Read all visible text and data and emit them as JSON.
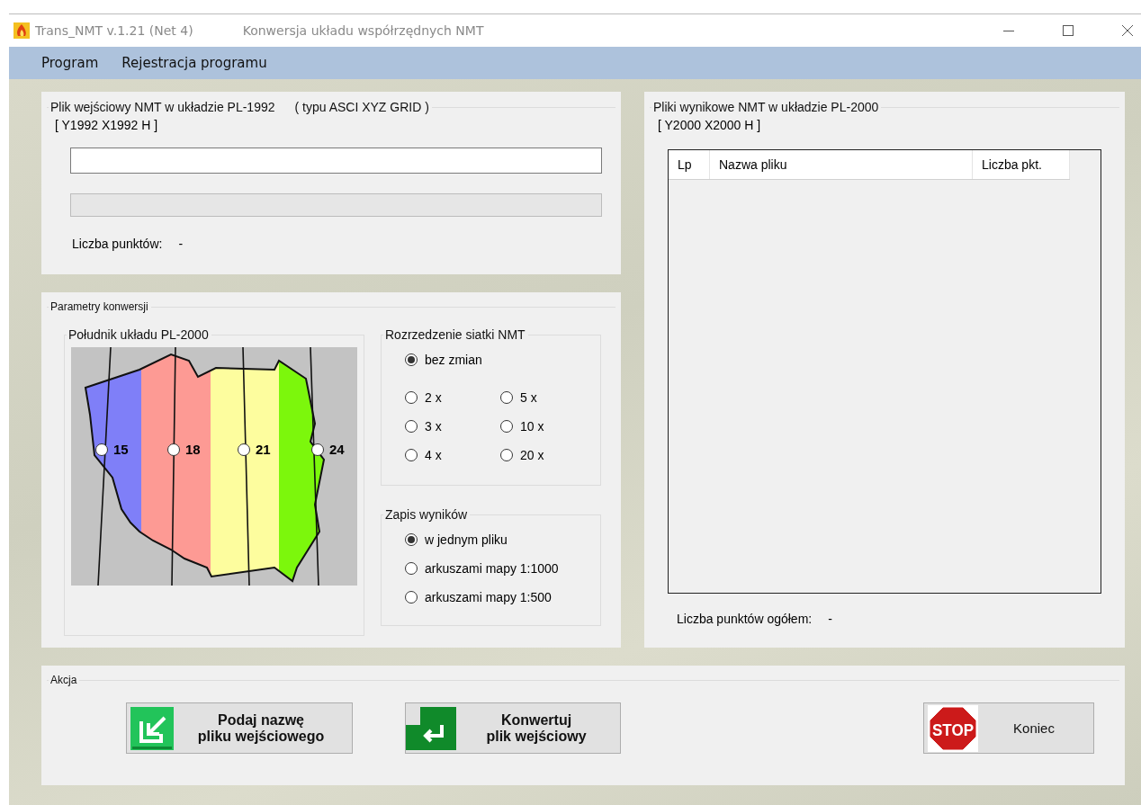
{
  "window": {
    "title": "Trans_NMT  v.1.21 (Net 4)",
    "subtitle": "Konwersja układu współrzędnych NMT"
  },
  "menu": [
    "Program",
    "Rejestracja programu"
  ],
  "input_panel": {
    "title": "Plik wejściowy NMT w układzie PL-1992",
    "title_note": "( typu ASCI XYZ GRID )",
    "coords": "[ Y1992 X1992 H ]",
    "progress": {
      "level": 0
    },
    "points_label": "Liczba punktów:",
    "points_value": "-"
  },
  "params": {
    "title": "Parametry konwersji",
    "meridian": {
      "title": "Południk układu PL-2000",
      "options": [
        {
          "label": "15",
          "selected": false
        },
        {
          "label": "18",
          "selected": false
        },
        {
          "label": "21",
          "selected": false
        },
        {
          "label": "24",
          "selected": false
        }
      ]
    },
    "thinning": {
      "title": "Rozrzedzenie siatki NMT",
      "options": [
        {
          "label": "bez zmian",
          "selected": true
        },
        {
          "label": "2 x",
          "selected": false
        },
        {
          "label": "5 x",
          "selected": false
        },
        {
          "label": "3 x",
          "selected": false
        },
        {
          "label": "10 x",
          "selected": false
        },
        {
          "label": "4 x",
          "selected": false
        },
        {
          "label": "20 x",
          "selected": false
        }
      ]
    },
    "output": {
      "title": "Zapis wyników",
      "options": [
        {
          "label": "w jednym pliku",
          "selected": true
        },
        {
          "label": "arkuszami mapy 1:1000",
          "selected": false
        },
        {
          "label": "arkuszami mapy 1:500",
          "selected": false
        }
      ]
    }
  },
  "results": {
    "title": "Pliki wynikowe NMT w układzie PL-2000",
    "coords": "[ Y2000 X2000 H ]",
    "columns": [
      "Lp",
      "Nazwa pliku",
      "Liczba pkt."
    ],
    "total_label": "Liczba punktów ogółem:",
    "total_value": "-"
  },
  "actions": {
    "title": "Akcja",
    "buttons": [
      {
        "kind": "browse",
        "label": "Podaj nazwę\npliku wejściowego"
      },
      {
        "kind": "convert",
        "label": "Konwertuj\nplik wejściowy"
      },
      {
        "kind": "stop",
        "label": "Koniec",
        "icon_text": "STOP"
      }
    ]
  }
}
